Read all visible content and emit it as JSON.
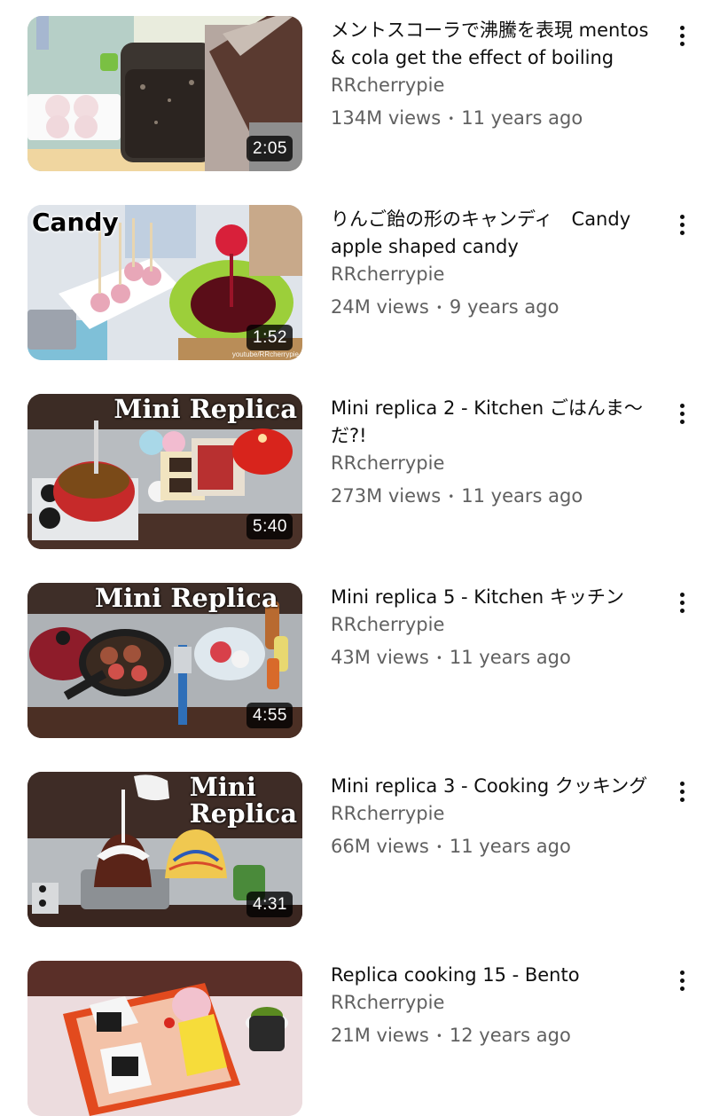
{
  "videos": [
    {
      "title": "メントスコーラで沸騰を表現 mentos & cola get the effect of boiling",
      "channel": "RRcherrypie",
      "views": "134M views",
      "age": "11 years ago",
      "duration": "2:05",
      "overlay": ""
    },
    {
      "title": "りんご飴の形のキャンディ　Candy apple shaped candy",
      "channel": "RRcherrypie",
      "views": "24M views",
      "age": "9 years ago",
      "duration": "1:52",
      "overlay": "Candy",
      "watermark": "youtube/RRcherrypie"
    },
    {
      "title": "Mini replica 2 - Kitchen ごはんま～だ?!",
      "channel": "RRcherrypie",
      "views": "273M views",
      "age": "11 years ago",
      "duration": "5:40",
      "overlay": "Mini Replica"
    },
    {
      "title": "Mini replica 5 - Kitchen キッチン",
      "channel": "RRcherrypie",
      "views": "43M views",
      "age": "11 years ago",
      "duration": "4:55",
      "overlay": "Mini Replica"
    },
    {
      "title": "Mini replica 3 - Cooking クッキング",
      "channel": "RRcherrypie",
      "views": "66M views",
      "age": "11 years ago",
      "duration": "4:31",
      "overlay": "Mini\nReplica"
    },
    {
      "title": "Replica cooking 15 - Bento",
      "channel": "RRcherrypie",
      "views": "21M views",
      "age": "12 years ago",
      "duration": "",
      "overlay": ""
    }
  ],
  "icons": {
    "more": "more-vert-icon"
  },
  "colors": {
    "title": "#0f0f0f",
    "secondary": "#606060",
    "duration_bg": "#000000cc"
  }
}
